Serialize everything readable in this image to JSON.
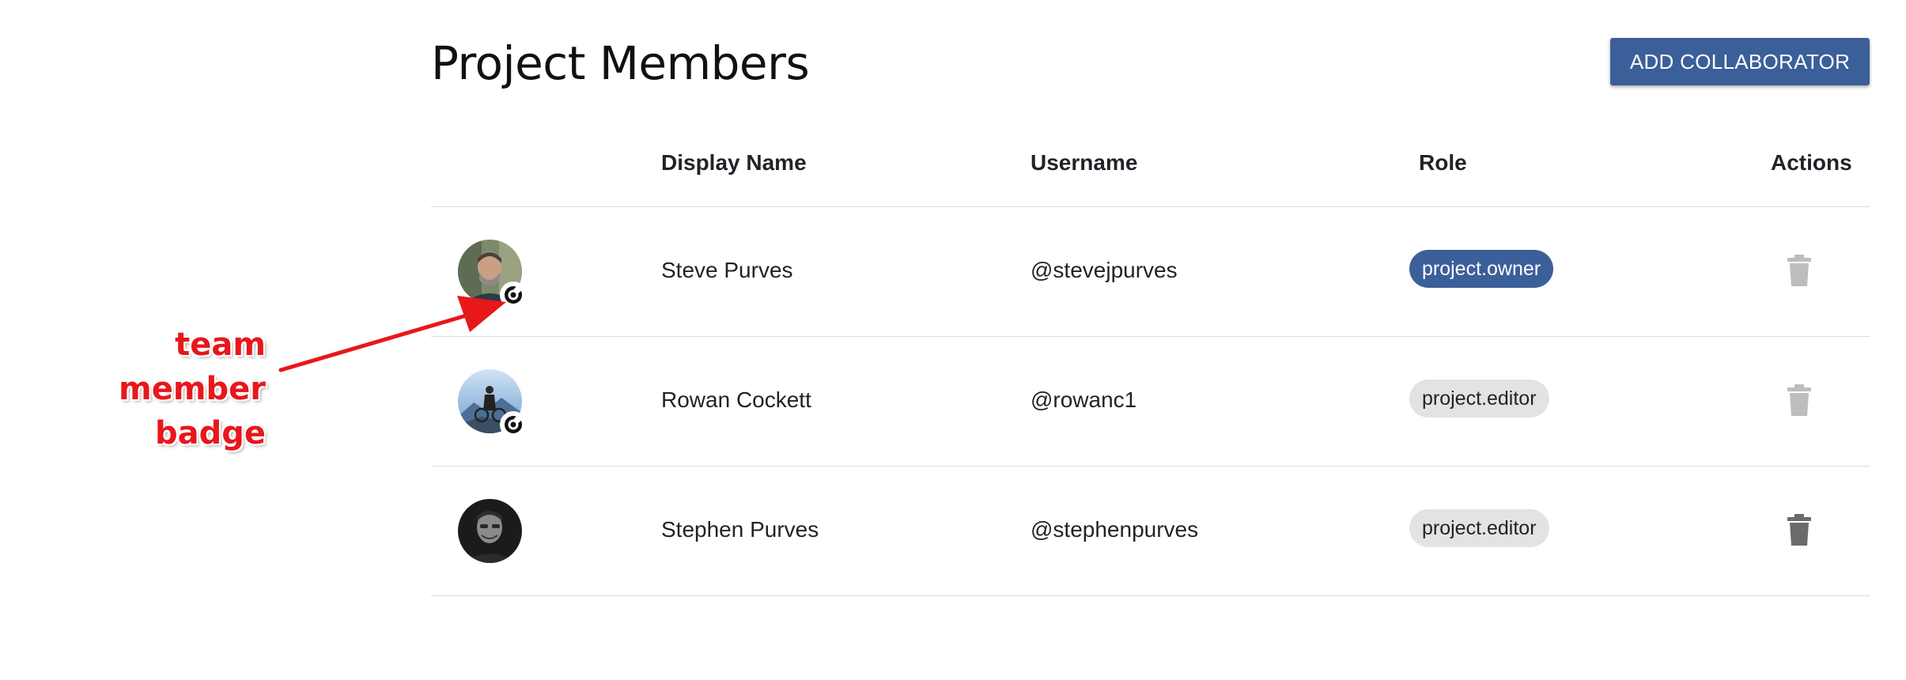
{
  "header": {
    "title": "Project Members",
    "add_button_label": "ADD COLLABORATOR"
  },
  "table": {
    "columns": [
      "",
      "Display Name",
      "Username",
      "Role",
      "Actions"
    ],
    "rows": [
      {
        "display_name": "Steve Purves",
        "username": "@stevejpurves",
        "role": "project.owner",
        "team_member_badge": true,
        "delete_enabled": false
      },
      {
        "display_name": "Rowan Cockett",
        "username": "@rowanc1",
        "role": "project.editor",
        "team_member_badge": true,
        "delete_enabled": false
      },
      {
        "display_name": "Stephen Purves",
        "username": "@stephenpurves",
        "role": "project.editor",
        "team_member_badge": false,
        "delete_enabled": true
      }
    ]
  },
  "annotation": {
    "line1": "team member",
    "line2": "badge"
  },
  "icons": {
    "badge": "target-badge-icon",
    "delete": "trash-icon"
  },
  "colors": {
    "primary": "#3b5f99",
    "annotation": "#e8171b",
    "trash_enabled": "#6b6b6b",
    "trash_disabled": "#bdbdbd",
    "chip_default": "#e3e3e3"
  }
}
